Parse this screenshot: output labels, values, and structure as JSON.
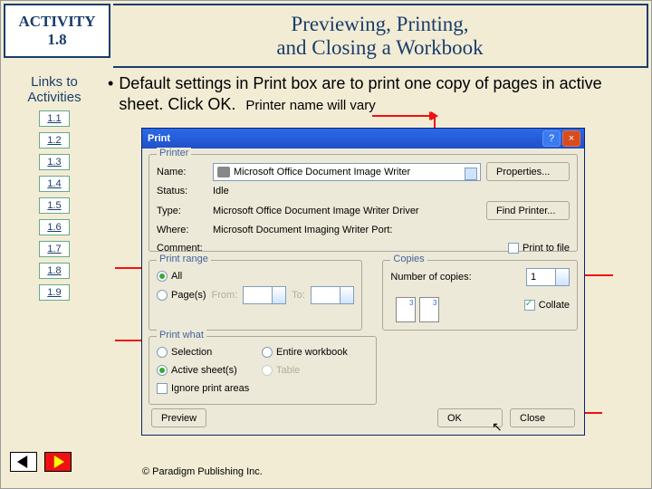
{
  "header": {
    "activity_label": "ACTIVITY",
    "activity_number": "1.8",
    "title_line1": "Previewing, Printing,",
    "title_line2": "and Closing a Workbook"
  },
  "sidebar": {
    "title": "Links to Activities",
    "items": [
      "1.1",
      "1.2",
      "1.3",
      "1.4",
      "1.5",
      "1.6",
      "1.7",
      "1.8",
      "1.9"
    ]
  },
  "main": {
    "bullet": "Default settings in Print box are to print one copy of pages in active sheet. Click OK.",
    "printer_note": "Printer name will vary"
  },
  "dialog": {
    "title": "Print",
    "help_icon": "?",
    "close_icon": "×",
    "printer_group": "Printer",
    "name_label": "Name:",
    "name_value": "Microsoft Office Document Image Writer",
    "status_label": "Status:",
    "status_value": "Idle",
    "type_label": "Type:",
    "type_value": "Microsoft Office Document Image Writer Driver",
    "where_label": "Where:",
    "where_value": "Microsoft Document Imaging Writer Port:",
    "comment_label": "Comment:",
    "properties_btn": "Properties...",
    "find_printer_btn": "Find Printer...",
    "print_to_file": "Print to file",
    "range_group": "Print range",
    "range_all": "All",
    "range_pages": "Page(s)",
    "from_label": "From:",
    "to_label": "To:",
    "copies_group": "Copies",
    "copies_label": "Number of copies:",
    "copies_value": "1",
    "collate": "Collate",
    "what_group": "Print what",
    "what_selection": "Selection",
    "what_entire": "Entire workbook",
    "what_active": "Active sheet(s)",
    "what_table": "Table",
    "ignore_areas": "Ignore print areas",
    "preview_btn": "Preview",
    "ok_btn": "OK",
    "close_btn": "Close"
  },
  "footer": {
    "copyright": "© Paradigm Publishing Inc."
  }
}
